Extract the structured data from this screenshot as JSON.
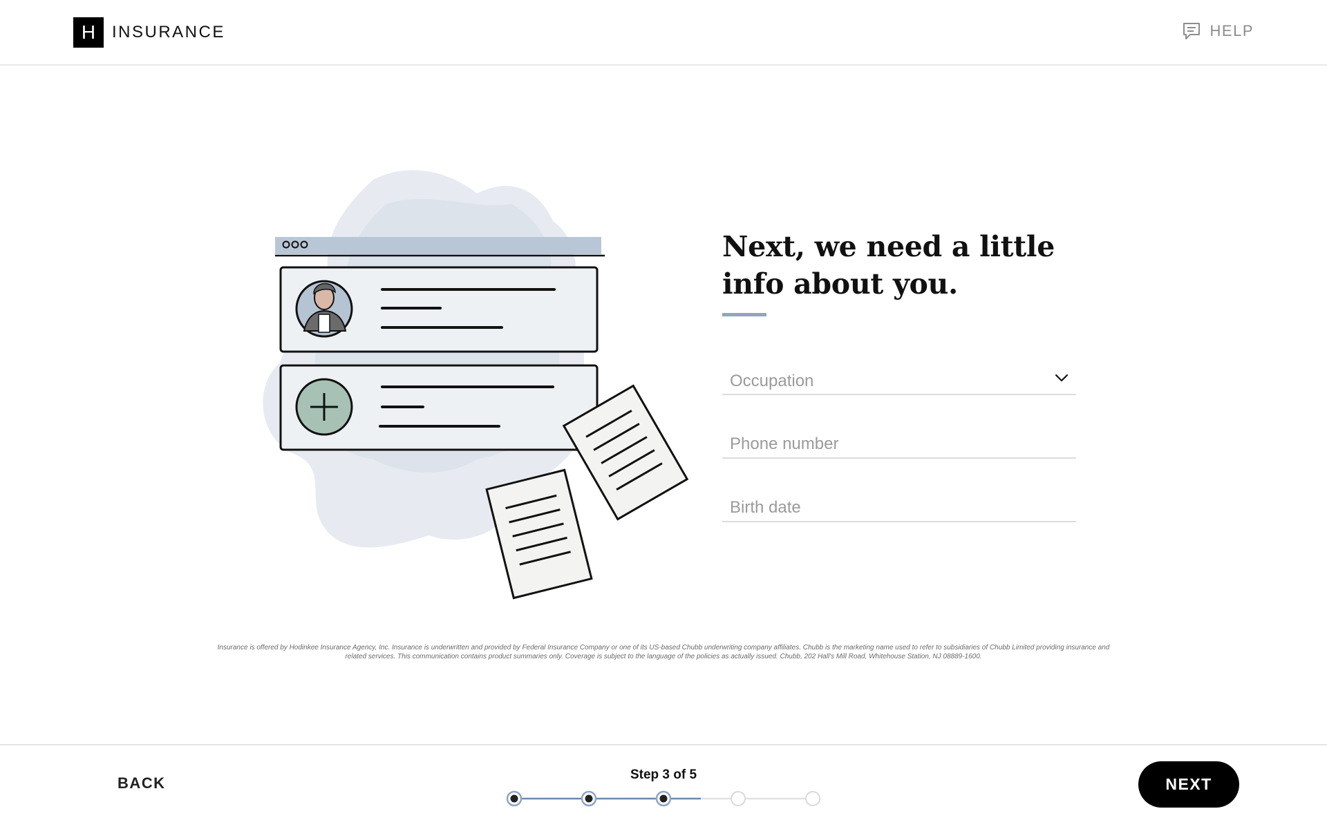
{
  "header": {
    "logo_letter": "H",
    "logo_text": "INSURANCE",
    "help_label": "HELP",
    "help_icon": "chat-bubble-icon"
  },
  "main": {
    "title": "Next, we need a little info about you.",
    "illustration": "profile-documents-illustration",
    "fields": {
      "occupation": {
        "placeholder": "Occupation",
        "icon": "chevron-down-icon"
      },
      "phone": {
        "placeholder": "Phone number"
      },
      "birth_date": {
        "placeholder": "Birth date"
      }
    },
    "disclaimer": "Insurance is offered by Hodinkee Insurance Agency, Inc. Insurance is underwritten and provided by Federal Insurance Company or one of its US-based Chubb underwriting company affiliates. Chubb is the marketing name used to refer to subsidiaries of Chubb Limited providing insurance and related services. This communication contains product summaries only. Coverage is subject to the language of the policies as actually issued. Chubb, 202 Hall's Mill Road, Whitehouse Station, NJ 08889-1600."
  },
  "footer": {
    "back_label": "BACK",
    "step_label": "Step 3 of 5",
    "current_step": 3,
    "total_steps": 5,
    "next_label": "NEXT"
  },
  "colors": {
    "accent": "#8ea5c3",
    "progress_active": "#6f87a8",
    "progress_inactive": "#d9d9d9",
    "button": "#000000"
  }
}
